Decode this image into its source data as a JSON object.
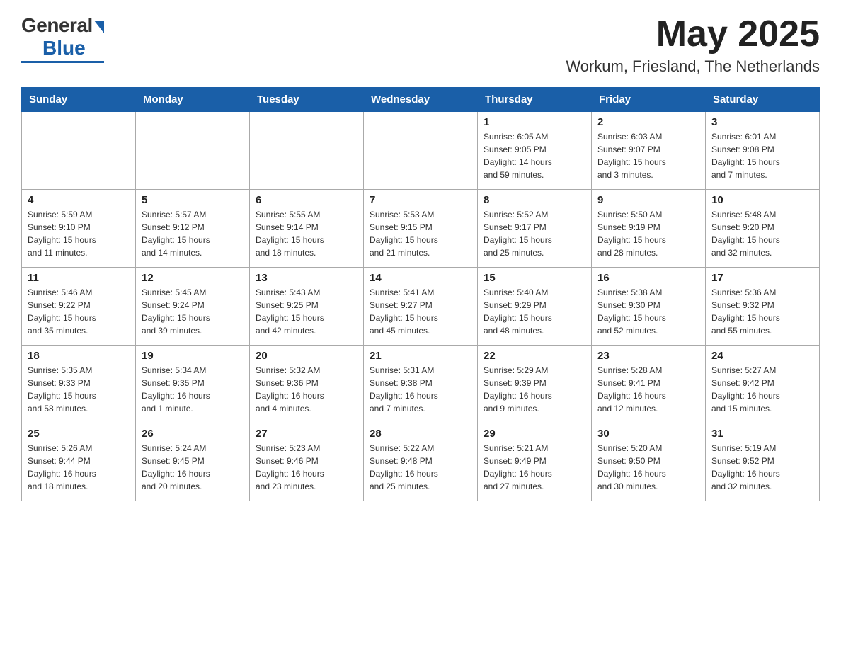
{
  "header": {
    "logo_general": "General",
    "logo_blue": "Blue",
    "month_title": "May 2025",
    "location": "Workum, Friesland, The Netherlands"
  },
  "weekdays": [
    "Sunday",
    "Monday",
    "Tuesday",
    "Wednesday",
    "Thursday",
    "Friday",
    "Saturday"
  ],
  "rows": [
    [
      {
        "day": "",
        "info": ""
      },
      {
        "day": "",
        "info": ""
      },
      {
        "day": "",
        "info": ""
      },
      {
        "day": "",
        "info": ""
      },
      {
        "day": "1",
        "info": "Sunrise: 6:05 AM\nSunset: 9:05 PM\nDaylight: 14 hours\nand 59 minutes."
      },
      {
        "day": "2",
        "info": "Sunrise: 6:03 AM\nSunset: 9:07 PM\nDaylight: 15 hours\nand 3 minutes."
      },
      {
        "day": "3",
        "info": "Sunrise: 6:01 AM\nSunset: 9:08 PM\nDaylight: 15 hours\nand 7 minutes."
      }
    ],
    [
      {
        "day": "4",
        "info": "Sunrise: 5:59 AM\nSunset: 9:10 PM\nDaylight: 15 hours\nand 11 minutes."
      },
      {
        "day": "5",
        "info": "Sunrise: 5:57 AM\nSunset: 9:12 PM\nDaylight: 15 hours\nand 14 minutes."
      },
      {
        "day": "6",
        "info": "Sunrise: 5:55 AM\nSunset: 9:14 PM\nDaylight: 15 hours\nand 18 minutes."
      },
      {
        "day": "7",
        "info": "Sunrise: 5:53 AM\nSunset: 9:15 PM\nDaylight: 15 hours\nand 21 minutes."
      },
      {
        "day": "8",
        "info": "Sunrise: 5:52 AM\nSunset: 9:17 PM\nDaylight: 15 hours\nand 25 minutes."
      },
      {
        "day": "9",
        "info": "Sunrise: 5:50 AM\nSunset: 9:19 PM\nDaylight: 15 hours\nand 28 minutes."
      },
      {
        "day": "10",
        "info": "Sunrise: 5:48 AM\nSunset: 9:20 PM\nDaylight: 15 hours\nand 32 minutes."
      }
    ],
    [
      {
        "day": "11",
        "info": "Sunrise: 5:46 AM\nSunset: 9:22 PM\nDaylight: 15 hours\nand 35 minutes."
      },
      {
        "day": "12",
        "info": "Sunrise: 5:45 AM\nSunset: 9:24 PM\nDaylight: 15 hours\nand 39 minutes."
      },
      {
        "day": "13",
        "info": "Sunrise: 5:43 AM\nSunset: 9:25 PM\nDaylight: 15 hours\nand 42 minutes."
      },
      {
        "day": "14",
        "info": "Sunrise: 5:41 AM\nSunset: 9:27 PM\nDaylight: 15 hours\nand 45 minutes."
      },
      {
        "day": "15",
        "info": "Sunrise: 5:40 AM\nSunset: 9:29 PM\nDaylight: 15 hours\nand 48 minutes."
      },
      {
        "day": "16",
        "info": "Sunrise: 5:38 AM\nSunset: 9:30 PM\nDaylight: 15 hours\nand 52 minutes."
      },
      {
        "day": "17",
        "info": "Sunrise: 5:36 AM\nSunset: 9:32 PM\nDaylight: 15 hours\nand 55 minutes."
      }
    ],
    [
      {
        "day": "18",
        "info": "Sunrise: 5:35 AM\nSunset: 9:33 PM\nDaylight: 15 hours\nand 58 minutes."
      },
      {
        "day": "19",
        "info": "Sunrise: 5:34 AM\nSunset: 9:35 PM\nDaylight: 16 hours\nand 1 minute."
      },
      {
        "day": "20",
        "info": "Sunrise: 5:32 AM\nSunset: 9:36 PM\nDaylight: 16 hours\nand 4 minutes."
      },
      {
        "day": "21",
        "info": "Sunrise: 5:31 AM\nSunset: 9:38 PM\nDaylight: 16 hours\nand 7 minutes."
      },
      {
        "day": "22",
        "info": "Sunrise: 5:29 AM\nSunset: 9:39 PM\nDaylight: 16 hours\nand 9 minutes."
      },
      {
        "day": "23",
        "info": "Sunrise: 5:28 AM\nSunset: 9:41 PM\nDaylight: 16 hours\nand 12 minutes."
      },
      {
        "day": "24",
        "info": "Sunrise: 5:27 AM\nSunset: 9:42 PM\nDaylight: 16 hours\nand 15 minutes."
      }
    ],
    [
      {
        "day": "25",
        "info": "Sunrise: 5:26 AM\nSunset: 9:44 PM\nDaylight: 16 hours\nand 18 minutes."
      },
      {
        "day": "26",
        "info": "Sunrise: 5:24 AM\nSunset: 9:45 PM\nDaylight: 16 hours\nand 20 minutes."
      },
      {
        "day": "27",
        "info": "Sunrise: 5:23 AM\nSunset: 9:46 PM\nDaylight: 16 hours\nand 23 minutes."
      },
      {
        "day": "28",
        "info": "Sunrise: 5:22 AM\nSunset: 9:48 PM\nDaylight: 16 hours\nand 25 minutes."
      },
      {
        "day": "29",
        "info": "Sunrise: 5:21 AM\nSunset: 9:49 PM\nDaylight: 16 hours\nand 27 minutes."
      },
      {
        "day": "30",
        "info": "Sunrise: 5:20 AM\nSunset: 9:50 PM\nDaylight: 16 hours\nand 30 minutes."
      },
      {
        "day": "31",
        "info": "Sunrise: 5:19 AM\nSunset: 9:52 PM\nDaylight: 16 hours\nand 32 minutes."
      }
    ]
  ]
}
